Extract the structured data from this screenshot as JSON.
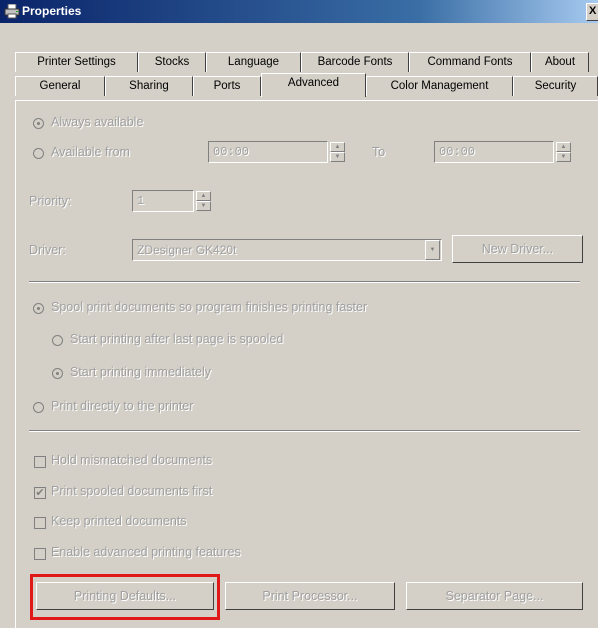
{
  "window": {
    "title": "Properties",
    "close_glyph": "X"
  },
  "tabs_row1": [
    "Printer Settings",
    "Stocks",
    "Language",
    "Barcode Fonts",
    "Command Fonts",
    "About"
  ],
  "tabs_row2": [
    "General",
    "Sharing",
    "Ports",
    "Advanced",
    "Color Management",
    "Security"
  ],
  "active_tab": "Advanced",
  "availability": {
    "always_label": "Always available",
    "from_label": "Available from",
    "from_value": "00:00",
    "to_label": "To",
    "to_value": "00:00",
    "selected": "always"
  },
  "priority": {
    "label": "Priority:",
    "value": "1"
  },
  "driver": {
    "label": "Driver:",
    "value": "ZDesigner GK420t",
    "new_driver_label": "New Driver..."
  },
  "spool": {
    "spool_label": "Spool print documents so program finishes printing faster",
    "after_last_label": "Start printing after last page is spooled",
    "immediately_label": "Start printing immediately",
    "direct_label": "Print directly to the printer"
  },
  "options": [
    {
      "label": "Hold mismatched documents",
      "checked": false
    },
    {
      "label": "Print spooled documents first",
      "checked": true
    },
    {
      "label": "Keep printed documents",
      "checked": false
    },
    {
      "label": "Enable advanced printing features",
      "checked": false
    }
  ],
  "buttons": {
    "printing_defaults": "Printing Defaults...",
    "print_processor": "Print Processor...",
    "separator_page": "Separator Page..."
  },
  "colors": {
    "title_start": "#0a246a",
    "title_end": "#a6caf0",
    "face": "#d4d0c8",
    "highlight": "#e01818",
    "disabled_text": "#a0a0a0"
  }
}
